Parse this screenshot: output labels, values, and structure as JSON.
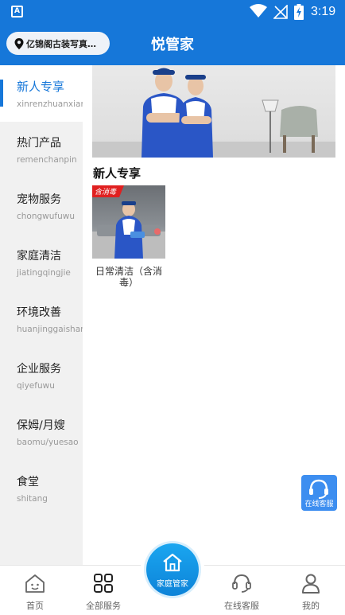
{
  "status_bar": {
    "time": "3:19",
    "app_badge": "A"
  },
  "header": {
    "location": "亿锦阁古装写真…",
    "title": "悦管家"
  },
  "sidebar": {
    "items": [
      {
        "cn": "新人专享",
        "py": "xinrenzhuanxian",
        "active": true
      },
      {
        "cn": "热门产品",
        "py": "remenchanpin"
      },
      {
        "cn": "宠物服务",
        "py": "chongwufuwu"
      },
      {
        "cn": "家庭清洁",
        "py": "jiatingqingjie"
      },
      {
        "cn": "环境改善",
        "py": "huanjinggaishan"
      },
      {
        "cn": "企业服务",
        "py": "qiyefuwu"
      },
      {
        "cn": "保姆/月嫂",
        "py": "baomu/yuesao"
      },
      {
        "cn": "食堂",
        "py": "shitang"
      }
    ]
  },
  "main": {
    "section_title": "新人专享",
    "products": [
      {
        "name": "日常清洁（含消毒）",
        "tag": "含消毒"
      }
    ]
  },
  "float_service": {
    "label": "在线客服"
  },
  "tabbar": {
    "tabs": [
      {
        "label": "首页",
        "icon": "home-face-icon"
      },
      {
        "label": "全部服务",
        "icon": "grid-icon"
      },
      {
        "label": "家庭管家",
        "icon": "house-icon"
      },
      {
        "label": "在线客服",
        "icon": "headset-icon"
      },
      {
        "label": "我的",
        "icon": "user-icon"
      }
    ]
  },
  "colors": {
    "brand_blue": "#1677d9",
    "accent_cyan": "#1aa6f0",
    "tag_red": "#e02020"
  }
}
